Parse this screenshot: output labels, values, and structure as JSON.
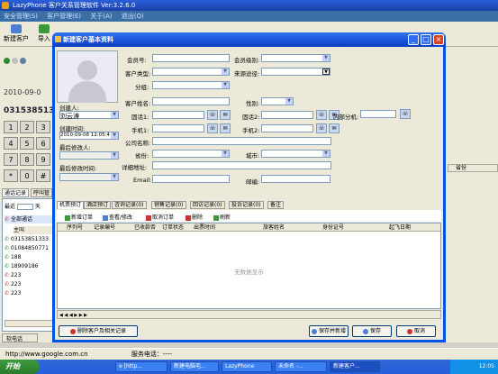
{
  "main": {
    "title": "LazyPhone 客户关系管理软件 Ver:3.2.6.0",
    "menu": [
      "安全管理(S)",
      "客户管理(E)",
      "关于(A)",
      "退出(Q)"
    ],
    "toolbar": {
      "new_customer": "新建客户",
      "import": "导入"
    }
  },
  "left": {
    "date": "2010-09-0",
    "phone_number": "03153851333",
    "keys": [
      "1",
      "2",
      "3",
      "4",
      "5",
      "6",
      "7",
      "8",
      "9",
      "*",
      "0",
      "#"
    ],
    "tabs": [
      "通话记录",
      "呼叫管"
    ],
    "filter_label": "最近",
    "filter_value": "天",
    "all_calls": "全部通话",
    "list_header": "主叫",
    "calls": [
      "03153851333",
      "01084850771",
      "188",
      "18909186",
      "223",
      "223",
      "223"
    ],
    "soft_phone": "软电话"
  },
  "right": {
    "col_header": "省份"
  },
  "status": {
    "url": "http://www.google.com.cn",
    "service_phone_label": "服务电话：",
    "service_phone_value": "----"
  },
  "taskbar": {
    "start": "开始",
    "tasks": [
      "e [http...",
      "新建电脑毛...",
      "LazyPhone",
      "未命名 -...",
      "新建客户..."
    ],
    "clock": "12:05"
  },
  "dialog": {
    "title": "新建客户基本资料",
    "creator_label": "创建人:",
    "creator_value": "刘云涛",
    "created_label": "创建时间:",
    "created_value": "2010-09-08 12:05:4",
    "modifier_label": "最后修改人:",
    "modified_label": "最后修改时间:",
    "fields": {
      "member_no": "会员号:",
      "member_level": "会员级别:",
      "customer_type": "客户类型:",
      "source": "来源途径:",
      "group": "分组:",
      "name": "客户姓名:",
      "gender": "性别:",
      "tel1": "固话1:",
      "tel2": "固话2:",
      "ext": "内部分机:",
      "mobile1": "手机1:",
      "mobile2": "手机2:",
      "company": "公司名称:",
      "province": "省份:",
      "city": "城市:",
      "address": "详细地址:",
      "email": "Email:",
      "postcode": "邮编:"
    },
    "tabs": [
      "机票预订",
      "酒店预订",
      "咨询记录(0)",
      "销售记录(0)",
      "回访记录(0)",
      "投诉记录(0)",
      "备注"
    ],
    "tools": [
      "新增订单",
      "查看/修改",
      "取消订单",
      "删除",
      "刷新"
    ],
    "columns": [
      "序列号",
      "记录编号",
      "已收款否",
      "订单状态",
      "出票时间",
      "旅客姓名",
      "身份证号",
      "起飞日期"
    ],
    "no_data": "无数据显示",
    "buttons": {
      "delete_customer": "删除客户及相关记录",
      "save_new": "保存并新增",
      "save": "保存",
      "cancel": "取消"
    }
  },
  "colors": {
    "titlebar": "#0a3cc4",
    "xp_bg": "#ece9d8",
    "taskbar": "#245edb",
    "start": "#2a7a2a"
  }
}
